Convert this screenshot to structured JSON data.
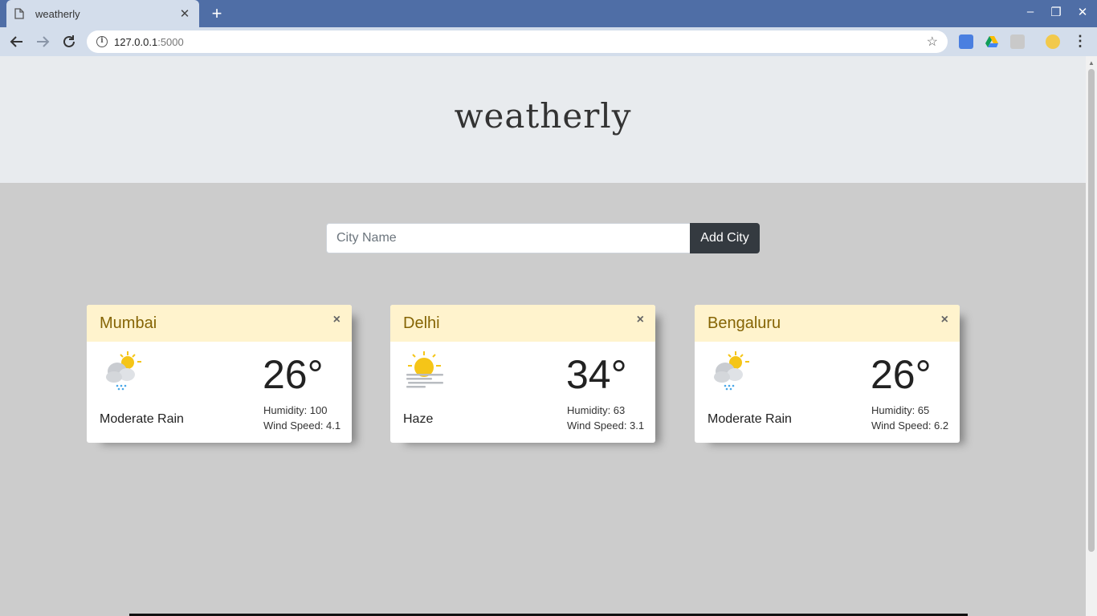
{
  "browser": {
    "tab_title": "weatherly",
    "url_host": "127.0.0.1",
    "url_port": ":5000"
  },
  "app": {
    "brand": "weatherly",
    "search": {
      "placeholder": "City Name",
      "value": "",
      "button_label": "Add City"
    },
    "cards": [
      {
        "city": "Mumbai",
        "temperature": "26°",
        "description": "Moderate Rain",
        "humidity": "Humidity: 100",
        "wind": "Wind Speed: 4.1",
        "icon": "sun-cloud-rain-icon"
      },
      {
        "city": "Delhi",
        "temperature": "34°",
        "description": "Haze",
        "humidity": "Humidity: 63",
        "wind": "Wind Speed: 3.1",
        "icon": "sun-haze-icon"
      },
      {
        "city": "Bengaluru",
        "temperature": "26°",
        "description": "Moderate Rain",
        "humidity": "Humidity: 65",
        "wind": "Wind Speed: 6.2",
        "icon": "sun-cloud-rain-icon"
      }
    ],
    "close_symbol": "×"
  },
  "colors": {
    "chrome_frame": "#4f6ea6",
    "chrome_toolbar": "#d3ddeb",
    "hero_bg": "#e8ebee",
    "page_bg": "#cccccc",
    "card_header_bg": "#fff3cd",
    "city_text": "#856404",
    "button_bg": "#343a40",
    "sun": "#f5c518"
  }
}
